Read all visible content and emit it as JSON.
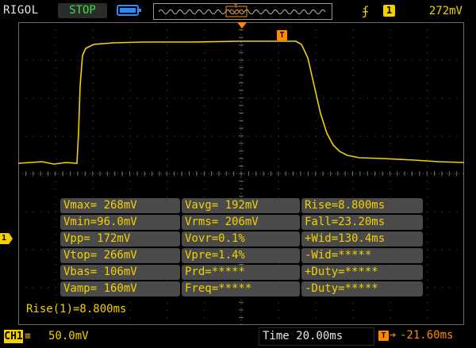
{
  "header": {
    "brand": "RIGOL",
    "run_state": "STOP",
    "trigger": {
      "edge_symbol": "ʄ",
      "source": "1",
      "level": "272mV"
    }
  },
  "markers": {
    "trigger_position_label": "T",
    "trigger_level_label": "T",
    "channel_label": "1"
  },
  "measurements": {
    "rows": [
      [
        "Vmax= 268mV",
        "Vavg= 192mV",
        "Rise=8.800ms"
      ],
      [
        "Vmin=96.0mV",
        "Vrms= 206mV",
        "Fall=23.20ms"
      ],
      [
        "Vpp= 172mV",
        "Vovr=0.1%",
        "+Wid=130.4ms"
      ],
      [
        "Vtop= 266mV",
        "Vpre=1.4%",
        "-Wid=*****"
      ],
      [
        "Vbas= 106mV",
        "Prd=*****",
        "+Duty=*****"
      ],
      [
        "Vamp= 160mV",
        "Freq=*****",
        "-Duty=*****"
      ]
    ]
  },
  "result_line": "Rise(1)=8.800ms",
  "footer": {
    "channel": "CH1",
    "coupling": "≡",
    "scale": "50.0mV",
    "timebase": "Time 20.00ms",
    "trigger_offset_icon": "T",
    "trigger_offset_arrow": "➔",
    "trigger_offset": "-21.60ms"
  },
  "colors": {
    "channel1": "#f2d100",
    "trigger": "#ff8a00",
    "run_state": "#3fe03f",
    "grid": "#5a5a5a"
  },
  "icons": {
    "battery": "battery-icon",
    "memory_depth": "memory-waveform-icon",
    "trigger_edge": "rising-edge-icon"
  }
}
